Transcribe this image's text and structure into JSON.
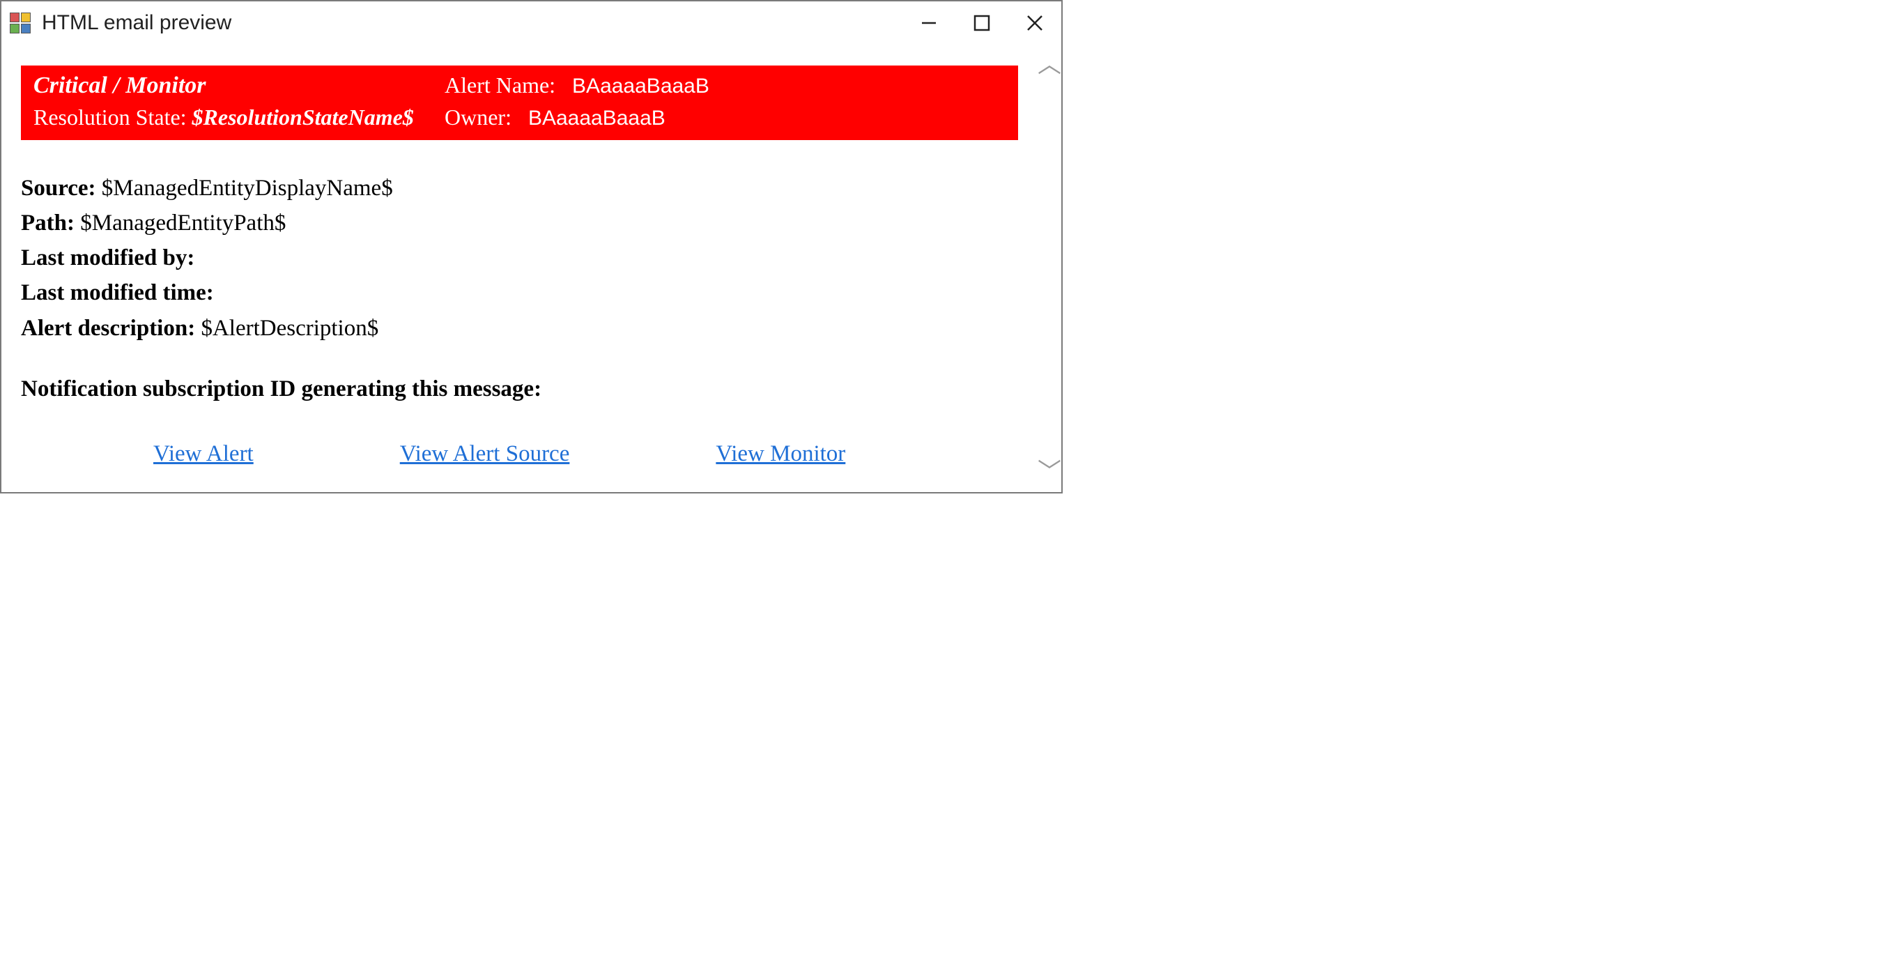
{
  "window": {
    "title": "HTML email preview"
  },
  "banner": {
    "severity": "Critical / Monitor",
    "alert_name_label": "Alert Name:",
    "alert_name_value": "BAaaaaBaaaB",
    "resolution_state_label": "Resolution State:",
    "resolution_state_value": "$ResolutionStateName$",
    "owner_label": "Owner:",
    "owner_value": "BAaaaaBaaaB"
  },
  "body": {
    "source_label": "Source:",
    "source_value": "$ManagedEntityDisplayName$",
    "path_label": "Path:",
    "path_value": "$ManagedEntityPath$",
    "last_modified_by_label": "Last modified by:",
    "last_modified_by_value": "",
    "last_modified_time_label": "Last modified time:",
    "last_modified_time_value": "",
    "alert_description_label": "Alert description:",
    "alert_description_value": "$AlertDescription$",
    "subscription_id_label": "Notification subscription ID generating this message:",
    "subscription_id_value": ""
  },
  "links": {
    "view_alert": "View Alert",
    "view_alert_source": "View Alert Source",
    "view_monitor": "View Monitor"
  },
  "colors": {
    "banner_bg": "#ff0000",
    "banner_fg": "#ffffff",
    "link_color": "#1f6fd6"
  }
}
